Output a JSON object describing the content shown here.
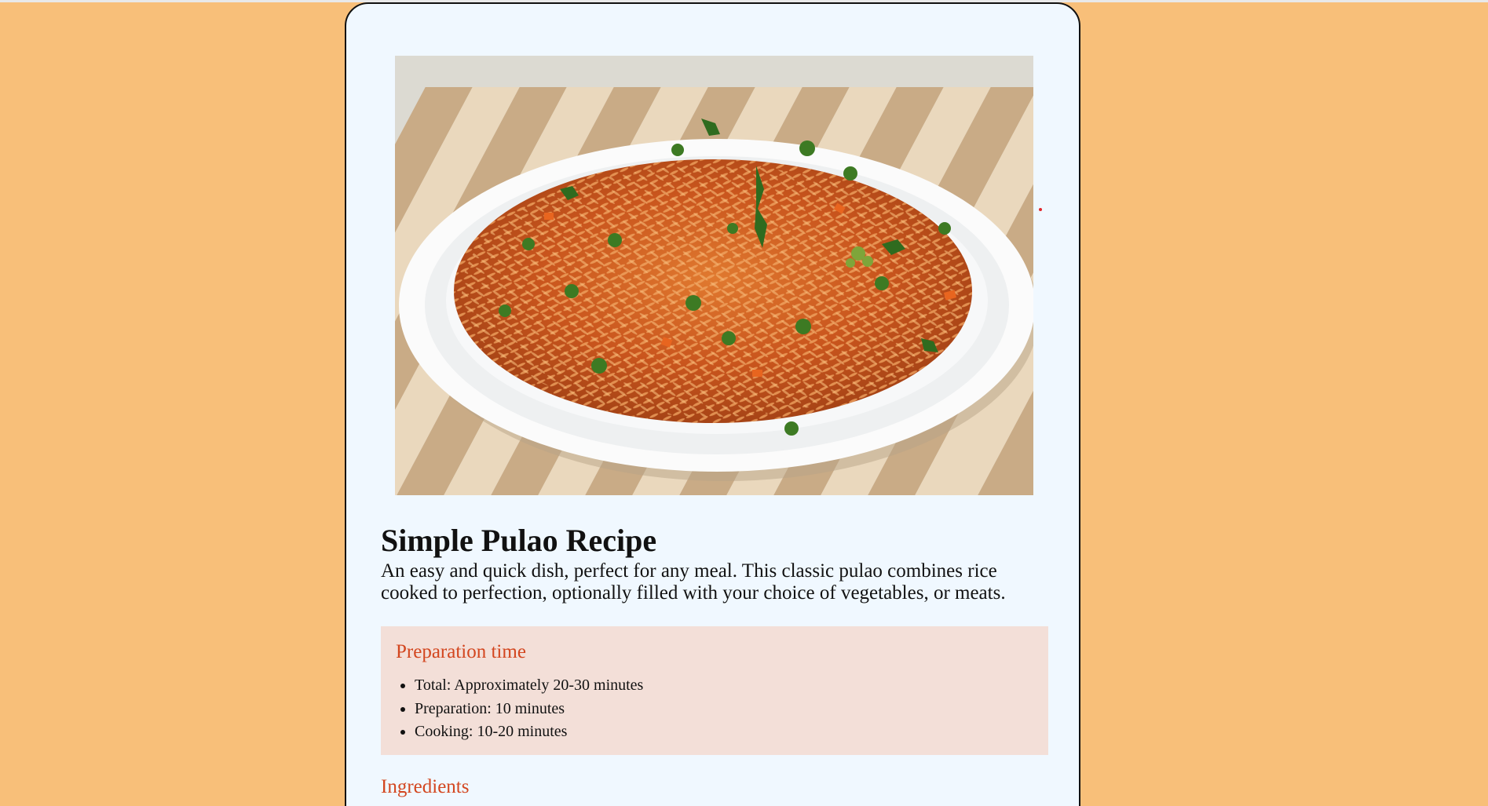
{
  "recipe": {
    "image": {
      "alt_icon": "pulao-plate-photo"
    },
    "title": "Simple Pulao Recipe",
    "description": "An easy and quick dish, perfect for any meal. This classic pulao combines rice cooked to perfection, optionally filled with your choice of vegetables, or meats.",
    "preparation": {
      "heading": "Preparation time",
      "items": [
        "Total: Approximately 20-30 minutes",
        "Preparation: 10 minutes",
        "Cooking: 10-20 minutes"
      ]
    },
    "ingredients": {
      "heading": "Ingredients"
    }
  },
  "colors": {
    "page_background": "#f8bf79",
    "card_background": "#f0f8ff",
    "section_heading": "#d3461f",
    "prep_background": "#f3dfd8"
  }
}
